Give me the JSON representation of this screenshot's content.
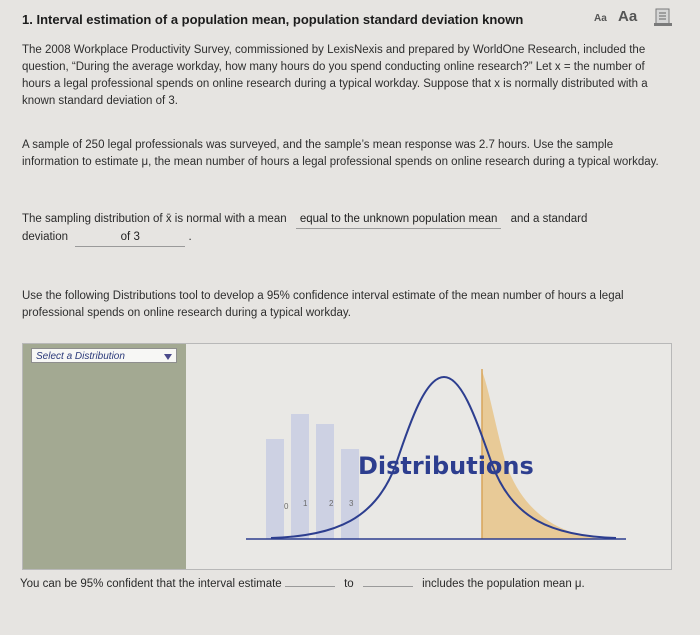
{
  "header": {
    "title": "1. Interval estimation of a population mean, population standard deviation known",
    "font_small": "Aa",
    "font_large": "Aa"
  },
  "paragraphs": {
    "p1": "The 2008 Workplace Productivity Survey, commissioned by LexisNexis and prepared by WorldOne Research, included the question, “During the average workday, how many hours do you spend conducting online research?” Let x = the number of hours a legal professional spends on online research during a typical workday. Suppose that x is normally distributed with a known standard deviation of 3.",
    "p2": "A sample of 250 legal professionals was surveyed, and the sample’s mean response was 2.7 hours. Use the sample information to estimate μ, the mean number of hours a legal professional spends on online research during a typical workday.",
    "p3": "Use the following Distributions tool to develop a 95% confidence interval estimate of the mean number of hours a legal professional spends on online research during a typical workday."
  },
  "sampling": {
    "prefix": "The sampling distribution of x̄ is normal with a mean",
    "mean_answer": "equal to the unknown population mean",
    "middle": "and a standard",
    "deviation_label": "deviation",
    "sd_answer": "of 3",
    "end": "."
  },
  "tool": {
    "select_label": "Select a Distribution",
    "watermark": "Distributions",
    "axis_ticks": [
      "0",
      "1",
      "2",
      "3"
    ],
    "colors": {
      "panel": "#a3a992",
      "curve": "#2d3e8f",
      "tail": "#e8c48a",
      "bars": "#bdc4e0"
    }
  },
  "bottom": {
    "prefix": "You can be 95% confident that the interval estimate",
    "middle": "to",
    "suffix": "includes the population mean μ."
  }
}
